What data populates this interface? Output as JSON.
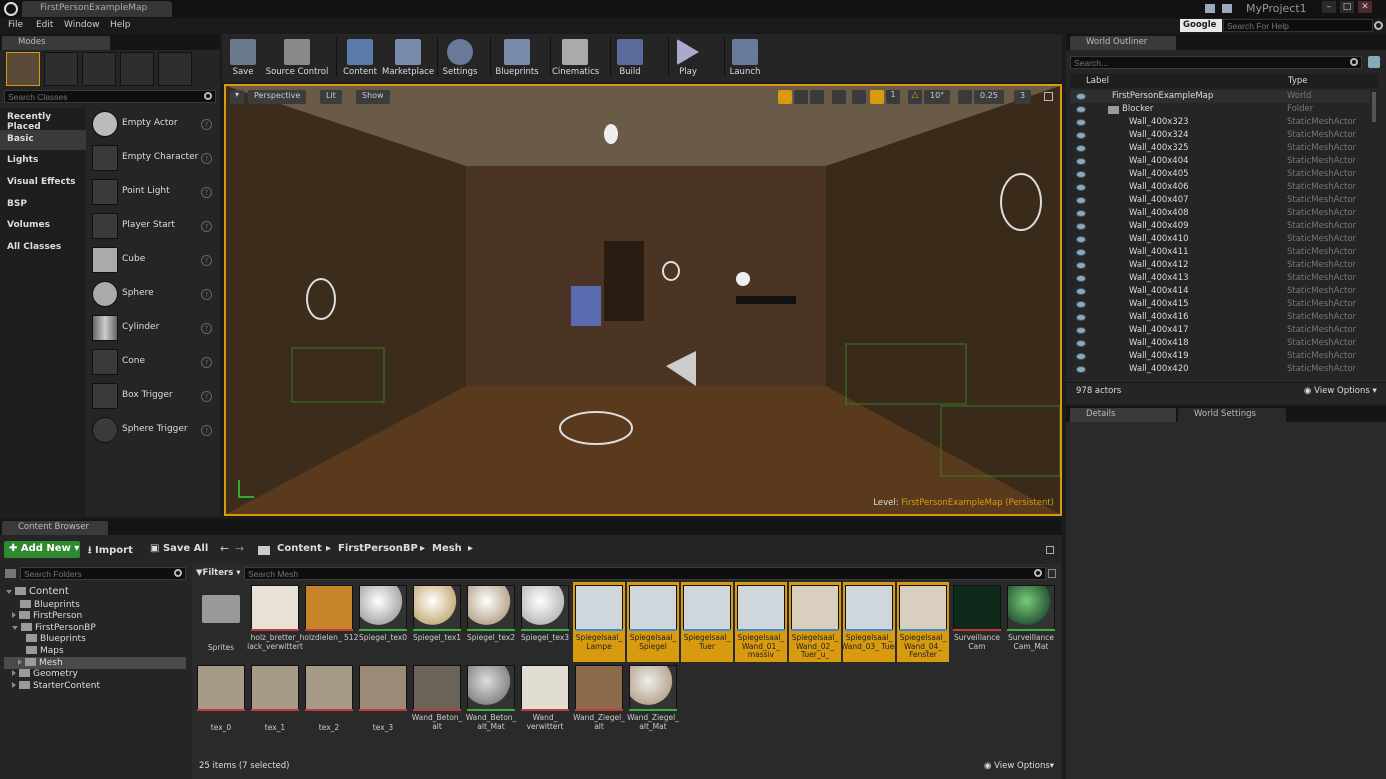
{
  "window": {
    "doc_tab": "FirstPersonExampleMap",
    "project": "MyProject1",
    "search_engine": "Google",
    "search_placeholder": "Search For Help"
  },
  "menu": [
    "File",
    "Edit",
    "Window",
    "Help"
  ],
  "modes": {
    "tab": "Modes",
    "search_placeholder": "Search Classes",
    "categories": [
      "Recently Placed",
      "Basic",
      "Lights",
      "Visual Effects",
      "BSP",
      "Volumes",
      "All Classes"
    ],
    "items": [
      "Empty Actor",
      "Empty Character",
      "Point Light",
      "Player Start",
      "Cube",
      "Sphere",
      "Cylinder",
      "Cone",
      "Box Trigger",
      "Sphere Trigger"
    ],
    "help": "?"
  },
  "toolbar": [
    "Save",
    "Source Control",
    "Content",
    "Marketplace",
    "Settings",
    "Blueprints",
    "Cinematics",
    "Build",
    "Play",
    "Launch"
  ],
  "viewport": {
    "perspective": "Perspective",
    "lit": "Lit",
    "show": "Show",
    "angle": "10°",
    "scale": "0.25",
    "speed": "3",
    "level_label": "Level:",
    "level_name": "FirstPersonExampleMap (Persistent)"
  },
  "outliner": {
    "tab": "World Outliner",
    "search_placeholder": "Search...",
    "col_label": "Label",
    "col_type": "Type",
    "root": {
      "label": "FirstPersonExampleMap",
      "type": "World"
    },
    "folder": {
      "label": "Blocker",
      "type": "Folder"
    },
    "rows": [
      "Wall_400x323",
      "Wall_400x324",
      "Wall_400x325",
      "Wall_400x404",
      "Wall_400x405",
      "Wall_400x406",
      "Wall_400x407",
      "Wall_400x408",
      "Wall_400x409",
      "Wall_400x410",
      "Wall_400x411",
      "Wall_400x412",
      "Wall_400x413",
      "Wall_400x414",
      "Wall_400x415",
      "Wall_400x416",
      "Wall_400x417",
      "Wall_400x418",
      "Wall_400x419",
      "Wall_400x420"
    ],
    "row_type": "StaticMeshActor",
    "count": "978 actors",
    "view_options": "View Options"
  },
  "details": {
    "tab": "Details",
    "world_settings": "World Settings"
  },
  "content_browser": {
    "tab": "Content Browser",
    "add_new": "Add New",
    "import": "Import",
    "save_all": "Save All",
    "path": [
      "Content",
      "FirstPersonBP",
      "Mesh"
    ],
    "search_folders": "Search Folders",
    "filters": "Filters",
    "search_mesh": "Search Mesh",
    "tree": [
      "Content",
      "Blueprints",
      "FirstPerson",
      "FirstPersonBP",
      "Blueprints",
      "Maps",
      "Mesh",
      "Geometry",
      "StarterContent"
    ],
    "assets_row1": [
      "Sprites",
      "holz_bretter_ lack_verwittert",
      "holzdielen_ 512",
      "Spiegel_tex0",
      "Spiegel_tex1",
      "Spiegel_tex2",
      "Spiegel_tex3",
      "Spiegelsaal_ Lampe",
      "Spiegelsaal_ Spiegel",
      "Spiegelsaal_ Tuer",
      "Spiegelsaal_ Wand_01_ massiv",
      "Spiegelsaal_ Wand_02_ Tuer_u_",
      "Spiegelsaal_ Wand_03_ Tuer",
      "Spiegelsaal_ Wand_04_ Fenster",
      "Surveillance Cam",
      "Surveillance Cam_Mat"
    ],
    "assets_row2": [
      "tex_0",
      "tex_1",
      "tex_2",
      "tex_3",
      "Wand_Beton_ alt",
      "Wand_Beton_ alt_Mat",
      "Wand_ verwittert",
      "Wand_Ziegel_ alt",
      "Wand_Ziegel_ alt_Mat"
    ],
    "status": "25 items (7 selected)",
    "view_options": "View Options"
  },
  "colors": {
    "accent": "#d89b10",
    "mesh_bar": "#3a8ad8",
    "material_bar": "#3ab13a",
    "texture_bar": "#c23a3a",
    "add_green": "#2f8a2f"
  }
}
